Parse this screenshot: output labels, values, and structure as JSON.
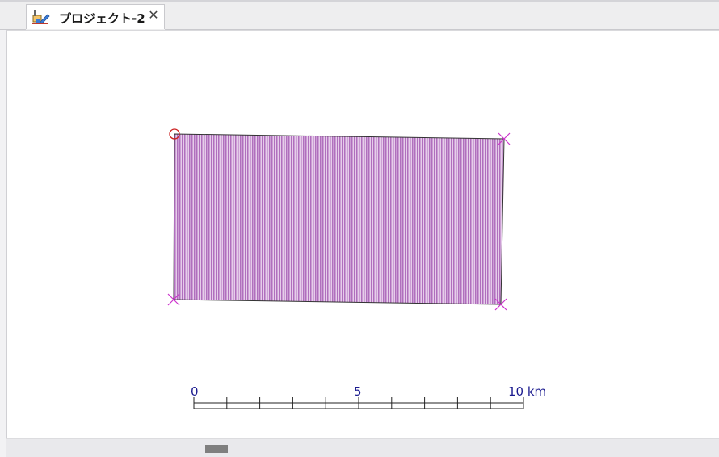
{
  "tab": {
    "title": "プロジェクト-2",
    "close_glyph": "✕",
    "icon": "project-icon"
  },
  "map": {
    "feature": {
      "fill_color": "#c58fd0",
      "stroke_color": "#333333",
      "marker_color": "#cc33cc",
      "start_marker_color": "#cc2222"
    },
    "scale_bar": {
      "labels": [
        "0",
        "5",
        "10 km"
      ],
      "divisions": 10,
      "color": "#1b1b8f"
    }
  },
  "scrollbar": {
    "orientation": "horizontal"
  }
}
